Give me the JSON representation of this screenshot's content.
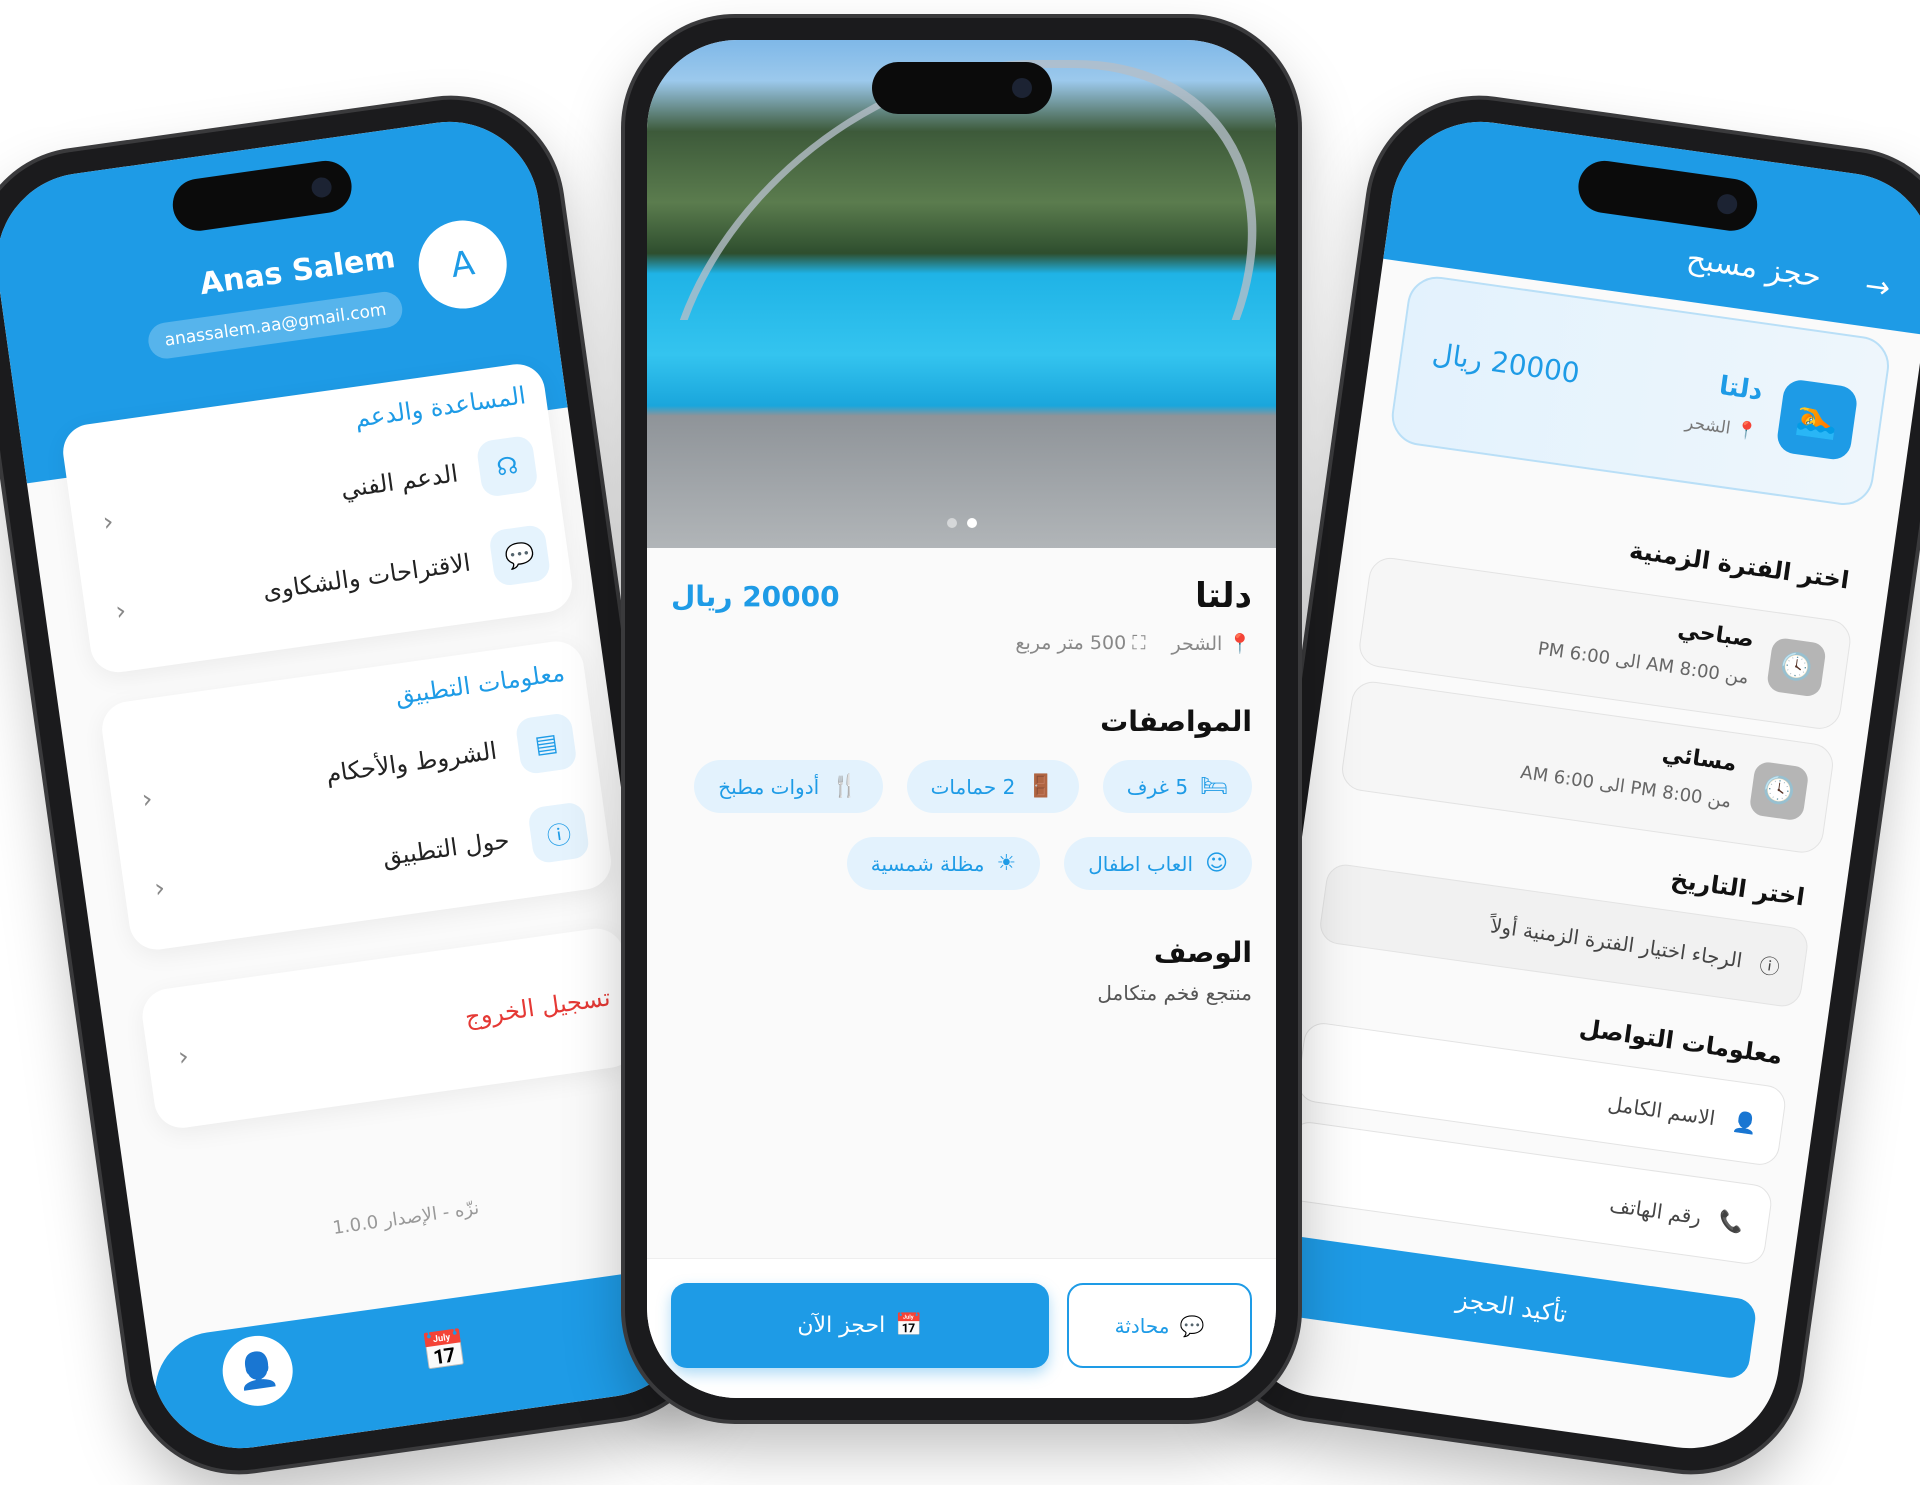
{
  "profile_screen": {
    "avatar_letter": "A",
    "user_name": "Anas Salem",
    "email": "anassalem.aa@gmail.com",
    "sections": [
      {
        "title": "المساعدة والدعم",
        "items": [
          {
            "label": "الدعم الفني",
            "icon": "headset-icon"
          },
          {
            "label": "الاقتراحات والشكاوى",
            "icon": "feedback-icon"
          }
        ]
      },
      {
        "title": "معلومات التطبيق",
        "items": [
          {
            "label": "الشروط والأحكام",
            "icon": "document-icon"
          },
          {
            "label": "حول التطبيق",
            "icon": "info-icon"
          }
        ]
      }
    ],
    "logout_label": "تسجيل الخروج",
    "version": "نزّه - الإصدار 1.0.0",
    "nav": [
      "profile-icon",
      "calendar-icon"
    ]
  },
  "detail_screen": {
    "title": "دلتا",
    "price": "20000 ريال",
    "location": "الشحر",
    "area": "500 متر مربع",
    "specs_title": "المواصفات",
    "specs": [
      {
        "label": "5 غرف",
        "icon": "bed-icon"
      },
      {
        "label": "2 حمامات",
        "icon": "bathroom-icon"
      },
      {
        "label": "أدوات مطبخ",
        "icon": "utensils-icon"
      },
      {
        "label": "العاب اطفال",
        "icon": "child-face-icon"
      },
      {
        "label": "مظلة شمسية",
        "icon": "sun-icon"
      }
    ],
    "description_title": "الوصف",
    "description": "منتجع فخم متكامل",
    "chat_label": "محادثة",
    "book_label": "احجز الآن",
    "carousel": {
      "count": 2,
      "active": 1
    }
  },
  "booking_screen": {
    "title": "حجز مسبح",
    "pool_name": "دلتا",
    "pool_location": "الشحر",
    "pool_price": "20000 ريال",
    "period_title": "اختر الفترة الزمنية",
    "slots": [
      {
        "name": "صباحي",
        "time": "من 8:00 AM الى 6:00 PM"
      },
      {
        "name": "مسائي",
        "time": "من 8:00 PM الى 6:00 AM"
      }
    ],
    "date_title": "اختر التاريخ",
    "date_hint": "الرجاء اختيار الفترة الزمنية أولاً",
    "contact_title": "معلومات التواصل",
    "name_placeholder": "الاسم الكامل",
    "phone_placeholder": "رقم الهاتف",
    "confirm_label": "تأكيد الحجز"
  },
  "colors": {
    "primary": "#1e9be6",
    "chip_bg": "#e3f2fd",
    "logout": "#e53935"
  }
}
